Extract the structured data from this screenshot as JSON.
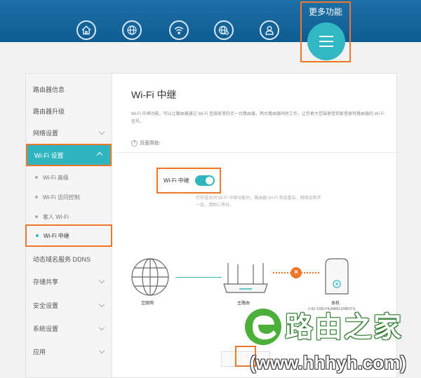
{
  "header": {
    "more_label": "更多功能",
    "nav_icons": [
      "home-icon",
      "globe-icon",
      "wifi-icon",
      "internet-settings-icon",
      "user-icon"
    ],
    "more_icon": "menu-icon",
    "bar_color": "#1565a3",
    "accent": "#32b8c2",
    "highlight": "#f0762b"
  },
  "sidebar": {
    "items": [
      {
        "label": "路由器信息"
      },
      {
        "label": "路由器升级"
      },
      {
        "label": "网络设置"
      },
      {
        "label": "Wi-Fi 设置"
      },
      {
        "label": "动态域名服务 DDNS"
      },
      {
        "label": "存储共享"
      },
      {
        "label": "安全设置"
      },
      {
        "label": "系统设置"
      },
      {
        "label": "应用"
      }
    ],
    "sub_items": [
      {
        "label": "Wi-Fi 高级"
      },
      {
        "label": "Wi-Fi 访问控制"
      },
      {
        "label": "客人 Wi-Fi"
      },
      {
        "label": "Wi-Fi 中继"
      }
    ]
  },
  "main": {
    "title": "Wi-Fi 中继",
    "description": "Wi-Fi 中继功能，可以让路由器通过 Wi-Fi 连接家里的另一台路由器，两台路由器同时工作，让你更大范围享受到家里原有路由器的 Wi-Fi 信号。",
    "help": "页面帮助",
    "toggle_label": "Wi-Fi 中继",
    "toggle_on": true,
    "hint": "打开或关闭 Wi-Fi 中继功能时，路由器 Wi-Fi 将会重启，网络会断开一会，请耐心等待。",
    "diagram": {
      "internet": "互联网",
      "main_router": "主路由",
      "this_device": "本机",
      "ssid": "2.4G SSID:HUAWEI-UNBOTS"
    }
  },
  "watermark": {
    "brand": "路由之家",
    "url": "(www.hhhyh.com)"
  }
}
